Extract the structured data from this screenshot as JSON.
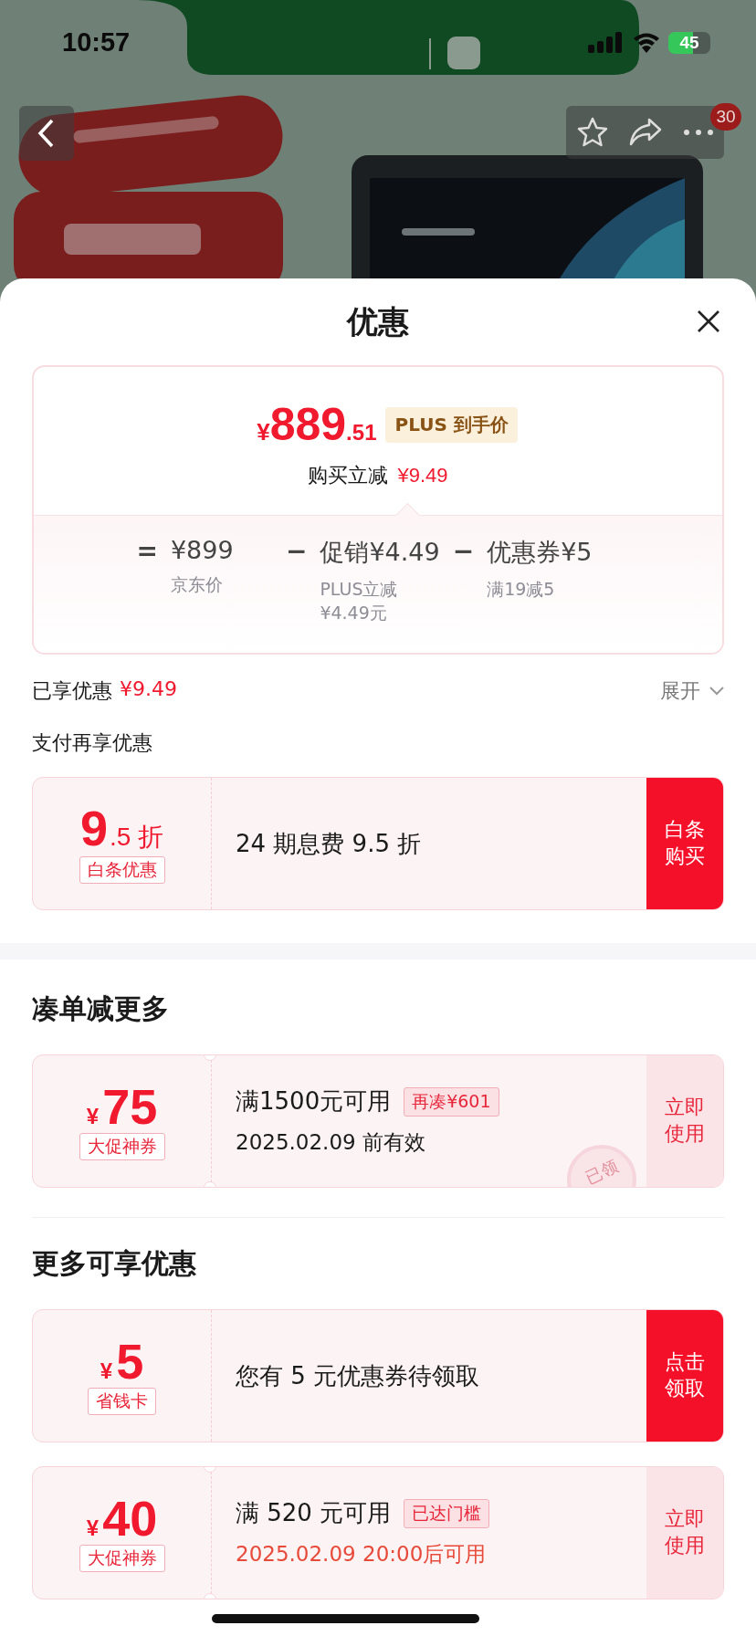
{
  "status_bar": {
    "time": "10:57",
    "battery": "45"
  },
  "nav": {
    "badge": "30"
  },
  "sheet": {
    "title": "优惠"
  },
  "price_card": {
    "price": {
      "currency": "¥",
      "integer": "889",
      "decimal": ".51"
    },
    "badge": "PLUS 到手价",
    "saving": {
      "label": "购买立减",
      "amount": "¥9.49"
    },
    "formula": [
      {
        "kind": "op",
        "text": "="
      },
      {
        "kind": "term",
        "value": "¥899",
        "note": "京东价"
      },
      {
        "kind": "op",
        "text": "−"
      },
      {
        "kind": "term",
        "value": "促销¥4.49",
        "note": "PLUS立减¥4.49元"
      },
      {
        "kind": "op",
        "text": "−"
      },
      {
        "kind": "term",
        "value": "优惠券¥5",
        "note": "满19减5"
      }
    ]
  },
  "enjoyed": {
    "label": "已享优惠",
    "amount": "¥9.49",
    "toggle": "展开",
    "expanded": false
  },
  "sections": [
    {
      "title": "支付再享优惠",
      "kind": "small",
      "coupons": [
        {
          "value": "9",
          "suffix": ".5 折",
          "tag": "白条优惠",
          "title": "24 期息费 9.5 折",
          "action": "白条购买",
          "action_highlighted": true,
          "notched": false
        }
      ]
    },
    {
      "title": "凑单减更多",
      "kind": "large",
      "coupons": [
        {
          "prefix": "¥",
          "value": "75",
          "tag": "大促神券",
          "title": "满1500元可用",
          "title_tag": "再凑¥601",
          "subtitle": "2025.02.09 前有效",
          "subtitle_alert": false,
          "action": "立即使用",
          "action_highlighted": false,
          "notched": true,
          "stamp": "已领"
        }
      ]
    },
    {
      "title": "更多可享优惠",
      "kind": "large",
      "coupons": [
        {
          "prefix": "¥",
          "value": "5",
          "tag": "省钱卡",
          "title": "您有 5 元优惠券待领取",
          "action": "点击领取",
          "action_highlighted": true,
          "notched": false
        },
        {
          "prefix": "¥",
          "value": "40",
          "tag": "大促神券",
          "title": "满 520 元可用",
          "title_tag": "已达门槛",
          "subtitle": "2025.02.09 20:00后可用",
          "subtitle_alert": true,
          "action": "立即使用",
          "action_highlighted": false,
          "notched": true
        }
      ]
    }
  ]
}
